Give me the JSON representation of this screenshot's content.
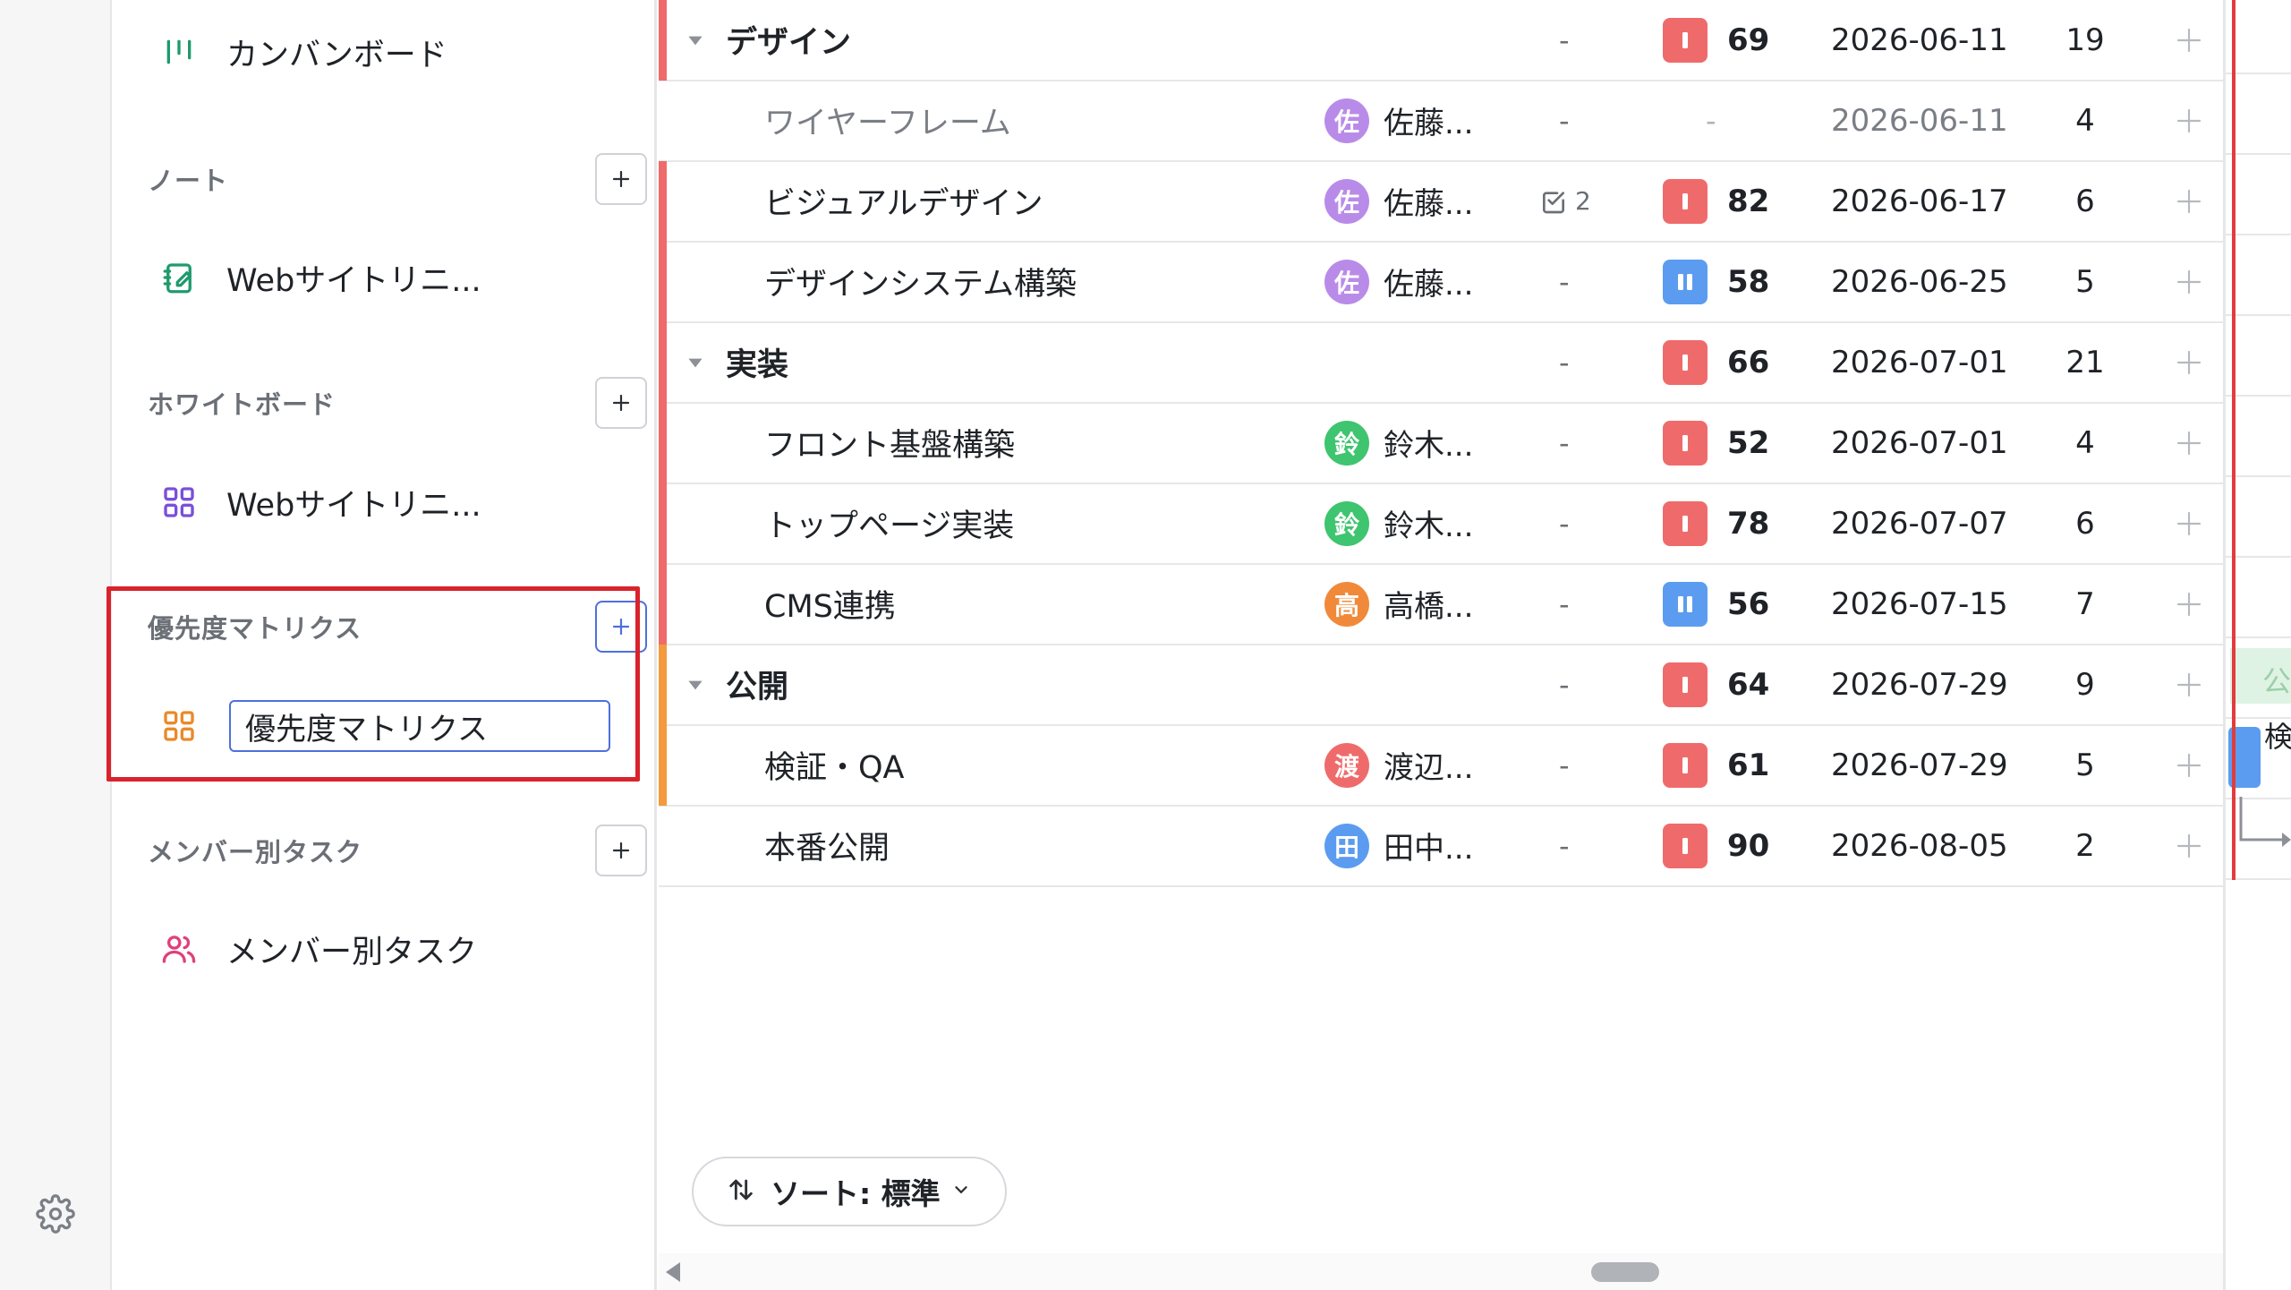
{
  "sidebar": {
    "kanban_label": "カンバンボード",
    "notes": {
      "header": "ノート",
      "item_label": "Webサイトリニ..."
    },
    "whiteboard": {
      "header": "ホワイトボード",
      "item_label": "Webサイトリニ..."
    },
    "priority_matrix": {
      "header": "優先度マトリクス",
      "input_value": "優先度マトリクス"
    },
    "member_tasks": {
      "header": "メンバー別タスク",
      "item_label": "メンバー別タスク"
    }
  },
  "table": {
    "rows": [
      {
        "type": "group",
        "name": "デザイン",
        "checklist": "-",
        "priority": "69",
        "priority_kind": "high",
        "date": "2026-06-11",
        "count": "19",
        "stripe": "#ef6b6b"
      },
      {
        "type": "task",
        "name": "ワイヤーフレーム",
        "avatar": "佐",
        "avatar_color": "#b98be8",
        "assignee": "佐藤...",
        "checklist": "-",
        "priority": "-",
        "priority_kind": "none",
        "date": "2026-06-11",
        "count": "4",
        "muted": true
      },
      {
        "type": "task",
        "name": "ビジュアルデザイン",
        "avatar": "佐",
        "avatar_color": "#b98be8",
        "assignee": "佐藤...",
        "checklist": "2",
        "priority": "82",
        "priority_kind": "high",
        "date": "2026-06-17",
        "count": "6",
        "stripe": "#ef6b6b"
      },
      {
        "type": "task",
        "name": "デザインシステム構築",
        "avatar": "佐",
        "avatar_color": "#b98be8",
        "assignee": "佐藤...",
        "checklist": "-",
        "priority": "58",
        "priority_kind": "medium",
        "date": "2026-06-25",
        "count": "5",
        "stripe": "#ef6b6b"
      },
      {
        "type": "group",
        "name": "実装",
        "checklist": "-",
        "priority": "66",
        "priority_kind": "high",
        "date": "2026-07-01",
        "count": "21",
        "stripe": "#ef6b6b"
      },
      {
        "type": "task",
        "name": "フロント基盤構築",
        "avatar": "鈴",
        "avatar_color": "#3fc46f",
        "assignee": "鈴木...",
        "checklist": "-",
        "priority": "52",
        "priority_kind": "high",
        "date": "2026-07-01",
        "count": "4",
        "stripe": "#ef6b6b"
      },
      {
        "type": "task",
        "name": "トップページ実装",
        "avatar": "鈴",
        "avatar_color": "#3fc46f",
        "assignee": "鈴木...",
        "checklist": "-",
        "priority": "78",
        "priority_kind": "high",
        "date": "2026-07-07",
        "count": "6",
        "stripe": "#ef6b6b"
      },
      {
        "type": "task",
        "name": "CMS連携",
        "avatar": "高",
        "avatar_color": "#f08a3a",
        "assignee": "高橋...",
        "checklist": "-",
        "priority": "56",
        "priority_kind": "medium",
        "date": "2026-07-15",
        "count": "7",
        "stripe": "#ef6b6b"
      },
      {
        "type": "group",
        "name": "公開",
        "checklist": "-",
        "priority": "64",
        "priority_kind": "high",
        "date": "2026-07-29",
        "count": "9",
        "stripe": "#f39a3e"
      },
      {
        "type": "task",
        "name": "検証・QA",
        "avatar": "渡",
        "avatar_color": "#ef6b6b",
        "assignee": "渡辺...",
        "checklist": "-",
        "priority": "61",
        "priority_kind": "high",
        "date": "2026-07-29",
        "count": "5",
        "stripe": "#f39a3e"
      },
      {
        "type": "task",
        "name": "本番公開",
        "avatar": "田",
        "avatar_color": "#5b9cf0",
        "assignee": "田中...",
        "checklist": "-",
        "priority": "90",
        "priority_kind": "high",
        "date": "2026-08-05",
        "count": "2"
      }
    ]
  },
  "sort": {
    "label": "ソート: 標準"
  },
  "gantt": {
    "bar_label_top": "公開",
    "bar_label_mid": "検"
  },
  "colors": {
    "high": "#ef6b6b",
    "medium": "#5b9cf0",
    "accent": "#4f6fdc",
    "highlight": "#d9232c",
    "today": "#e23c3c"
  }
}
